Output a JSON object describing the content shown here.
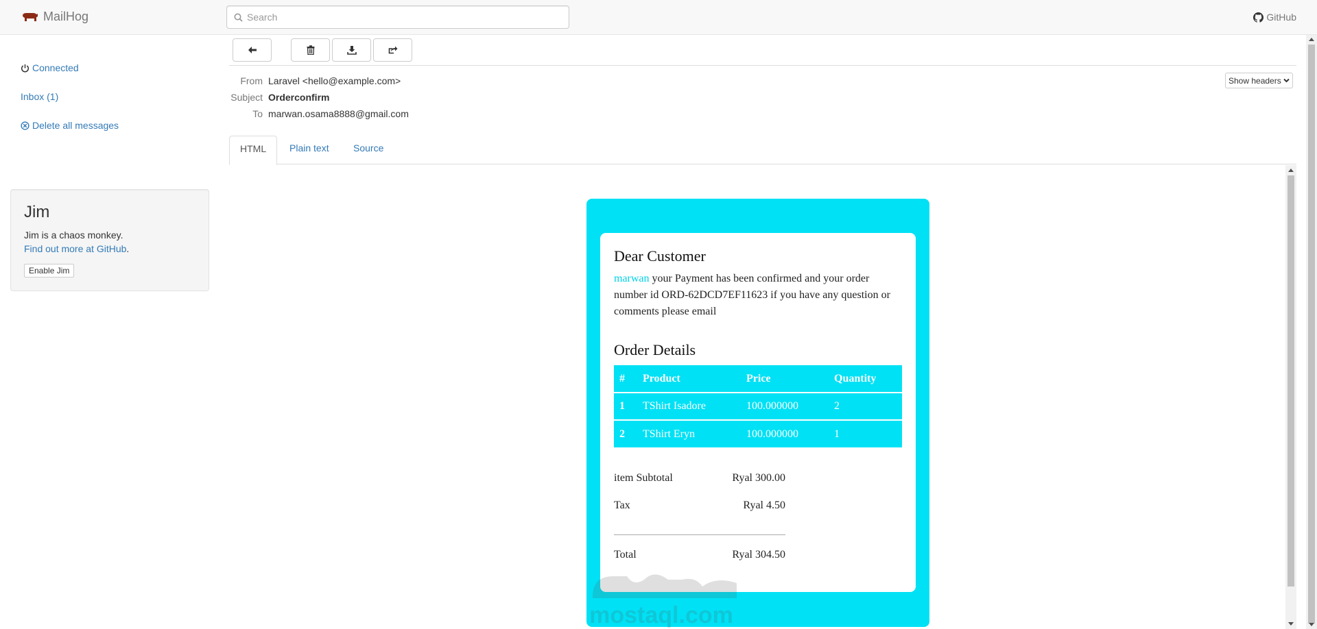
{
  "navbar": {
    "brand": "MailHog",
    "search_placeholder": "Search",
    "github": "GitHub"
  },
  "sidebar": {
    "connected": "Connected",
    "inbox": "Inbox (1)",
    "delete_all": "Delete all messages",
    "jim": {
      "title": "Jim",
      "description": "Jim is a chaos monkey.",
      "link": "Find out more at GitHub",
      "link_suffix": ".",
      "button": "Enable Jim"
    }
  },
  "message": {
    "from_label": "From",
    "from": "Laravel <hello@example.com>",
    "subject_label": "Subject",
    "subject": "Orderconfirm",
    "to_label": "To",
    "to": "marwan.osama8888@gmail.com",
    "show_headers": "Show headers"
  },
  "tabs": [
    "HTML",
    "Plain text",
    "Source"
  ],
  "email": {
    "greeting": "Dear Customer",
    "name": "marwan",
    "intro": " your Payment has been confirmed and your order number id ORD-62DCD7EF11623 if you have any question or comments please email",
    "order_heading": "Order Details",
    "columns": [
      "#",
      "Product",
      "Price",
      "Quantity"
    ],
    "rows": [
      [
        "1",
        "TShirt Isadore",
        "100.000000",
        "2"
      ],
      [
        "2",
        "TShirt Eryn",
        "100.000000",
        "1"
      ]
    ],
    "subtotal_label": "item Subtotal",
    "subtotal": "Ryal 300.00",
    "tax_label": "Tax",
    "tax": "Ryal 4.50",
    "total_label": "Total",
    "total": "Ryal 304.50"
  },
  "watermark": {
    "text": "mostaql.com"
  },
  "colors": {
    "accent": "#00e1f5",
    "link": "#337ab7"
  }
}
